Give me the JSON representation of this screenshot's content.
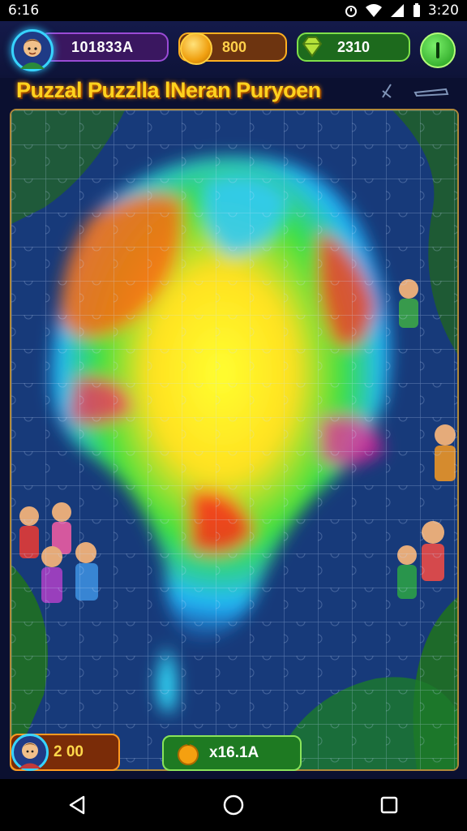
{
  "status_bar": {
    "time_left": "6:16",
    "time_right": "3:20"
  },
  "hud": {
    "player_name": "101833A",
    "coins": "800",
    "gems": "2310",
    "avatar_icon": "player-avatar-icon",
    "coin_icon": "coin-icon",
    "gem_icon": "gem-icon",
    "action_icon": "pause-icon"
  },
  "title": {
    "text": "Puzzal Puzzlla lNeran Puryoen"
  },
  "board": {
    "theme": "jigsaw-map",
    "frame_color": "#b08a3a"
  },
  "bottom_hud": {
    "moves": "2 00",
    "score": "x16.1A",
    "score_icon": "apple-icon"
  },
  "nav": {
    "back_icon": "back-triangle-icon",
    "home_icon": "home-circle-icon",
    "recent_icon": "recent-square-icon"
  },
  "colors": {
    "accent_gold": "#ffd21e",
    "accent_green": "#7fe04a",
    "accent_orange": "#ff9a20"
  }
}
